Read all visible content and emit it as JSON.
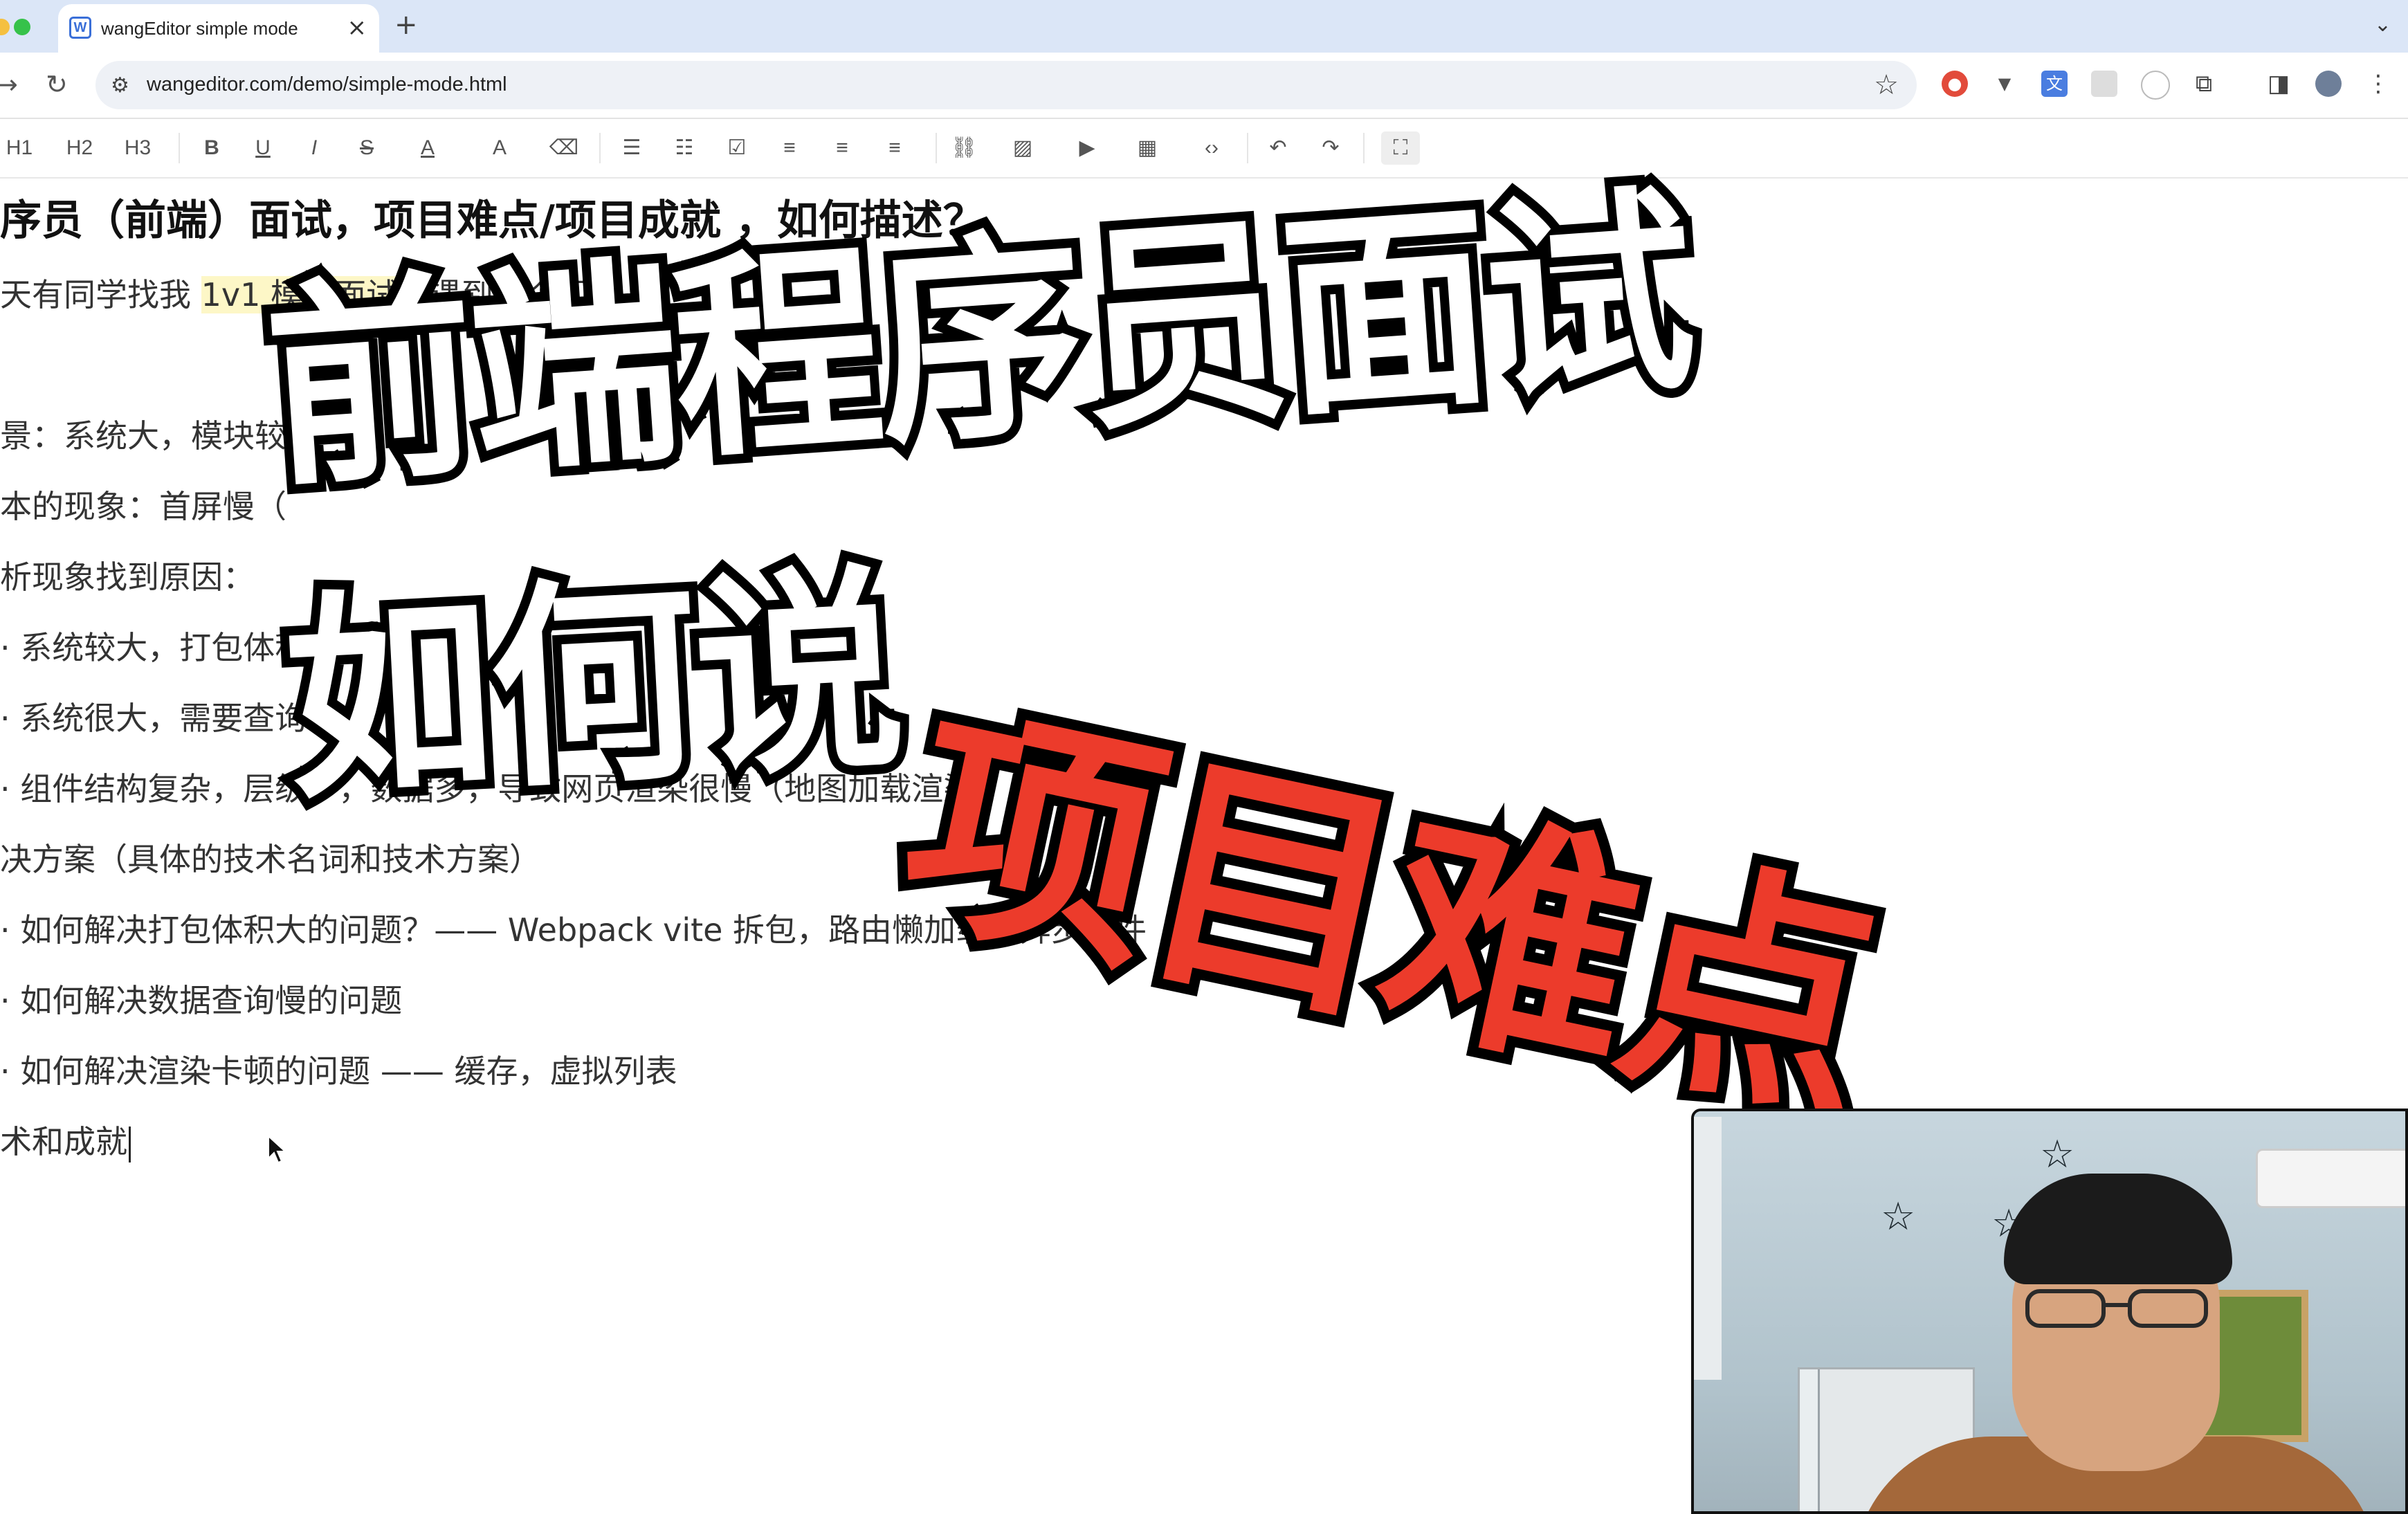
{
  "browser": {
    "tab_title": "wangEditor simple mode",
    "tab_favicon": "W",
    "url": "wangeditor.com/demo/simple-mode.html",
    "new_tab": "+",
    "close": "×",
    "back": "→",
    "reload": "↻",
    "bookmark_star": "☆",
    "tab_dropdown": "⌄"
  },
  "toolbar": {
    "h1": "H1",
    "h2": "H2",
    "h3": "H3",
    "bold": "B",
    "underline": "U",
    "italic": "I",
    "strike": "S",
    "font_color": "A",
    "bg_color": "A",
    "clear": "⌫",
    "bulleted": "☰",
    "numbered": "☷",
    "todo": "☑",
    "align_left": "≡",
    "align_center": "≡",
    "align_justify": "≡",
    "link": "⛓",
    "image": "▨",
    "video": "▶",
    "table": "▦",
    "code": "‹›",
    "undo": "↶",
    "redo": "↷",
    "fullscreen": "⛶"
  },
  "editor": {
    "title": "序员（前端）面试，项目难点/项目成就 ，如何描述？",
    "intro_before": "天有同学找我 ",
    "intro_highlight": "1v1 模拟面试",
    "intro_after": "，遇到这个问题。",
    "lines": [
      "景：系统大，模块较",
      "本的现象：首屏慢（",
      "析现象找到原因：",
      "· 系统较大，打包体积",
      "· 系统很大，需要查询",
      "· 组件结构复杂，层级多，数据多，导致网页渲染很慢（地图加载渲染",
      "决方案（具体的技术名词和技术方案）",
      "· 如何解决打包体积大的问题？—— Webpack vite 拆包，路由懒加载，异步组件",
      "· 如何解决数据查询慢的问题",
      "· 如何解决渲染卡顿的问题 —— 缓存，虚拟列表",
      "术和成就"
    ]
  },
  "overlay": {
    "line1": "前端程序员面试",
    "line2": "如何说",
    "line3": "项目难点"
  },
  "colors": {
    "overlay_red": "#ec3b2b",
    "highlight": "#fdf7c7",
    "chrome_tabbar": "#dbe6f7"
  }
}
